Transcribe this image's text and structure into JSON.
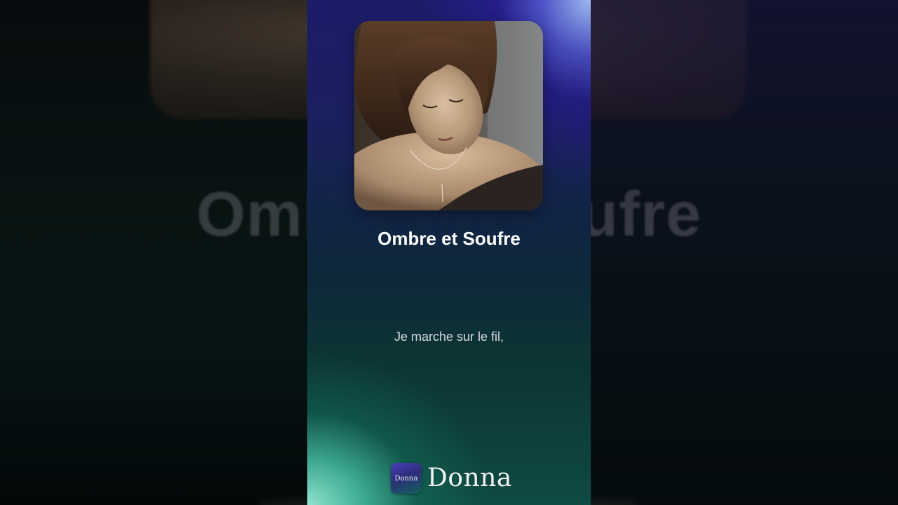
{
  "background": {
    "blurred_title": "Ombre et Soufre"
  },
  "video": {
    "cover_art": {
      "description_icon": "portrait-photo"
    },
    "song_title": "Ombre et Soufre",
    "lyric_line": "Je marche sur le fil,",
    "brand": {
      "logo_text": "Donna",
      "name": "Donna"
    }
  },
  "colors": {
    "title_text": "#ffffff",
    "lyric_text": "#d6dbe0",
    "gradient_top": "#1c1c6a",
    "gradient_bottom": "#0f4a44",
    "accent_teal": "#8fe3cf",
    "accent_blue": "#9db9f0"
  }
}
